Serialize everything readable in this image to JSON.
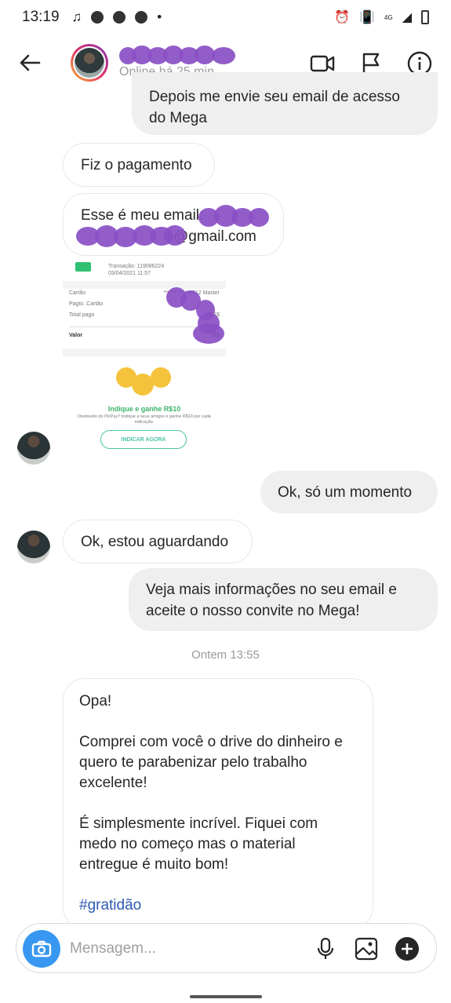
{
  "status_bar": {
    "time": "13:19",
    "network_label": "4G",
    "icons": [
      "music-icon",
      "messenger-icon",
      "messenger-icon",
      "messenger-icon",
      "dot",
      "alarm-icon",
      "vibrate-icon",
      "call-icon",
      "signal-icon",
      "battery-icon"
    ]
  },
  "header": {
    "contact_status": "Online há 25 min",
    "icons": [
      "back-arrow-icon",
      "video-call-icon",
      "flag-icon",
      "info-icon"
    ]
  },
  "messages": {
    "m1": "Depois me envie seu email de acesso do Mega",
    "m2": "Fiz o pagamento",
    "m3_line1": "Esse é meu email:",
    "m3_line2": "@gmail.com",
    "m5": "Ok, só um momento",
    "m6": "Ok, estou aguardando",
    "m7": "Veja mais informações no seu email e aceite o nosso convite no Mega!",
    "timestamp": "Ontem 13:55",
    "m8_p1": "Opa!",
    "m8_p2": "Comprei com você o drive do dinheiro e quero te parabenizar pelo trabalho excelente!",
    "m8_p3": "É simplesmente incrível. Fiquei com medo no começo mas o material entregue é muito bom!",
    "m8_hashtag": "#gratidão"
  },
  "receipt": {
    "transaction": "Transação: 119086224",
    "date": "03/04/2021 11:57",
    "rows": [
      {
        "label": "Cartão",
        "value": "************4512 Master"
      },
      {
        "label": "Pagto. Cartão",
        "value": ""
      },
      {
        "label": "Total pago",
        "value": "R$"
      },
      {
        "label": "Valor",
        "value": "R$"
      }
    ],
    "promo_title": "Indique e ganhe R$10",
    "promo_text": "Destravite do PicPay? Indique a seus amigos e ganhe R$10 por cada indicação.",
    "button_label": "INDICAR AGORA"
  },
  "composer": {
    "placeholder": "Mensagem...",
    "icons": [
      "camera-icon",
      "microphone-icon",
      "gallery-icon",
      "add-icon"
    ]
  },
  "colors": {
    "sent_bubble": "#efefef",
    "camera_button": "#3897f0",
    "hashtag": "#2c5bb4",
    "promo_green": "#3bb36a"
  }
}
